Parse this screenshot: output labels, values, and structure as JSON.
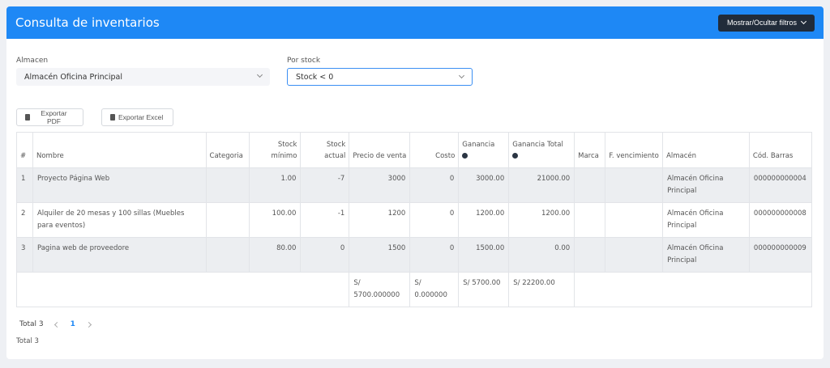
{
  "header": {
    "title": "Consulta de inventarios",
    "filter_toggle_label": "Mostrar/Ocultar filtros"
  },
  "filters": {
    "almacen_label": "Almacen",
    "almacen_value": "Almacén Oficina Principal",
    "stock_label": "Por stock",
    "stock_value": "Stock < 0"
  },
  "exports": {
    "pdf_label": "Exportar PDF",
    "excel_label": "Exportar Excel"
  },
  "table": {
    "headers": {
      "num": "#",
      "nombre": "Nombre",
      "categoria": "Categoria",
      "stock_minimo": "Stock mínimo",
      "stock_actual": "Stock actual",
      "precio_venta": "Precio de venta",
      "costo": "Costo",
      "ganancia": "Ganancia",
      "ganancia_total": "Ganancia Total",
      "marca": "Marca",
      "vencimiento": "F. vencimiento",
      "almacen": "Almacén",
      "cod_barras": "Cód. Barras"
    },
    "rows": [
      {
        "num": "1",
        "nombre": "Proyecto Página Web",
        "categoria": "",
        "stock_minimo": "1.00",
        "stock_actual": "-7",
        "precio_venta": "3000",
        "costo": "0",
        "ganancia": "3000.00",
        "ganancia_total": "21000.00",
        "marca": "",
        "vencimiento": "",
        "almacen": "Almacén Oficina Principal",
        "cod_barras": "000000000004"
      },
      {
        "num": "2",
        "nombre": "Alquiler de 20 mesas y 100 sillas (Muebles para eventos)",
        "categoria": "",
        "stock_minimo": "100.00",
        "stock_actual": "-1",
        "precio_venta": "1200",
        "costo": "0",
        "ganancia": "1200.00",
        "ganancia_total": "1200.00",
        "marca": "",
        "vencimiento": "",
        "almacen": "Almacén Oficina Principal",
        "cod_barras": "000000000008"
      },
      {
        "num": "3",
        "nombre": "Pagina web de proveedore",
        "categoria": "",
        "stock_minimo": "80.00",
        "stock_actual": "0",
        "precio_venta": "1500",
        "costo": "0",
        "ganancia": "1500.00",
        "ganancia_total": "0.00",
        "marca": "",
        "vencimiento": "",
        "almacen": "Almacén Oficina Principal",
        "cod_barras": "000000000009"
      }
    ],
    "totals": {
      "precio_venta": "S/ 5700.000000",
      "costo": "S/ 0.000000",
      "ganancia": "S/ 5700.00",
      "ganancia_total": "S/ 22200.00"
    }
  },
  "pagination": {
    "total_label": "Total 3",
    "current_page": "1"
  },
  "footer": {
    "total_label": "Total 3"
  },
  "colors": {
    "header_bg": "#1e88f5",
    "filter_button_bg": "#212c3a",
    "gray_row": "#eceef1",
    "accent": "#1e88f5"
  }
}
